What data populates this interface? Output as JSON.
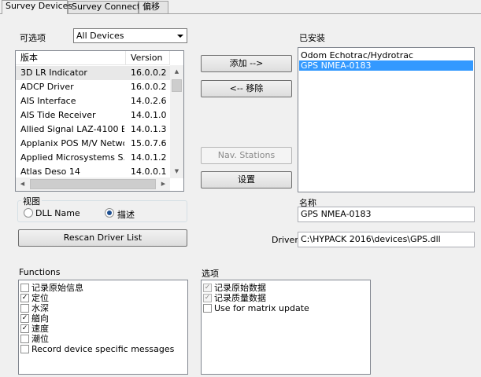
{
  "tabs": [
    {
      "label": "Survey Devices",
      "active": true
    },
    {
      "label": "Survey Connect",
      "active": false
    },
    {
      "label": "偏移",
      "active": false
    }
  ],
  "available": {
    "label": "可选项",
    "filter_value": "All Devices",
    "columns": [
      "版本",
      "Version"
    ],
    "rows": [
      {
        "name": "3D LR Indicator",
        "version": "16.0.0.2"
      },
      {
        "name": "ADCP Driver",
        "version": "16.0.0.2"
      },
      {
        "name": "AIS Interface",
        "version": "14.0.2.6"
      },
      {
        "name": "AIS Tide Receiver",
        "version": "14.0.1.0"
      },
      {
        "name": "Allied Signal LAZ-4100 E...",
        "version": "14.0.1.3"
      },
      {
        "name": "Applanix POS M/V Network",
        "version": "15.0.7.6"
      },
      {
        "name": "Applied Microsystems S...",
        "version": "14.0.1.2"
      },
      {
        "name": "Atlas Deso 14",
        "version": "14.0.0.1"
      }
    ]
  },
  "buttons": {
    "add": "添加 -->",
    "remove": "<-- 移除",
    "nav_stations": "Nav. Stations",
    "setup": "设置",
    "rescan": "Rescan Driver List"
  },
  "installed": {
    "label": "已安装",
    "items": [
      {
        "label": "Odom Echotrac/Hydrotrac",
        "selected": false
      },
      {
        "label": "GPS NMEA-0183",
        "selected": true
      }
    ]
  },
  "view": {
    "label": "视图",
    "options": [
      {
        "label": "DLL Name",
        "selected": false
      },
      {
        "label": "描述",
        "selected": true
      }
    ]
  },
  "name_field": {
    "label": "名称",
    "value": "GPS NMEA-0183"
  },
  "driver_field": {
    "label": "Driver",
    "value": "C:\\HYPACK 2016\\devices\\GPS.dll"
  },
  "functions": {
    "label": "Functions",
    "items": [
      {
        "label": "记录原始信息",
        "checked": false
      },
      {
        "label": "定位",
        "checked": true
      },
      {
        "label": "水深",
        "checked": false
      },
      {
        "label": "艏向",
        "checked": true
      },
      {
        "label": "速度",
        "checked": true
      },
      {
        "label": "潮位",
        "checked": false
      },
      {
        "label": "Record device specific messages",
        "checked": false
      }
    ]
  },
  "options": {
    "label": "选项",
    "items": [
      {
        "label": "记录原始数据",
        "checked": true,
        "disabled": true
      },
      {
        "label": "记录质量数据",
        "checked": true,
        "disabled": true
      },
      {
        "label": "Use for matrix update",
        "checked": false,
        "disabled": false
      }
    ]
  },
  "colors": {
    "selection": "#3399ff",
    "window_bg": "#f0f0f0"
  }
}
